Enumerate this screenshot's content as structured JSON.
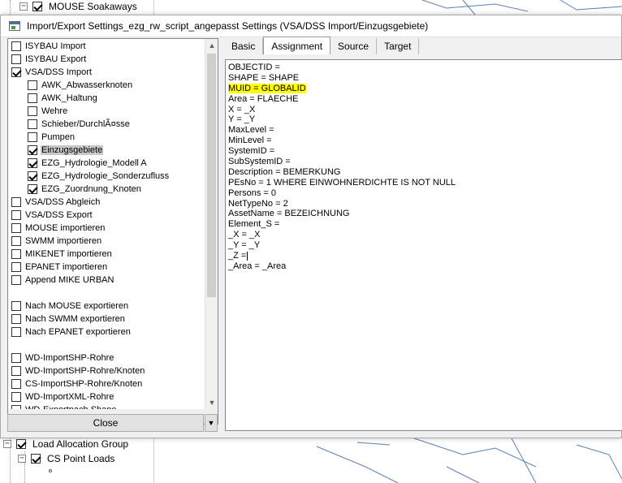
{
  "background": {
    "top_item": {
      "label": "MOUSE Soakaways",
      "checked": true
    },
    "bottom_items": [
      {
        "label": "Load Allocation Group",
        "checked": true
      },
      {
        "label": "CS Point Loads",
        "checked": true
      }
    ]
  },
  "dialog": {
    "title": "Import/Export Settings_ezg_rw_script_angepasst Settings (VSA/DSS Import/Einzugsgebiete)",
    "list_items": [
      {
        "label": "ISYBAU Import",
        "checked": false,
        "indent": 0
      },
      {
        "label": "ISYBAU Export",
        "checked": false,
        "indent": 0
      },
      {
        "label": "VSA/DSS Import",
        "checked": true,
        "indent": 0
      },
      {
        "label": "AWK_Abwasserknoten",
        "checked": false,
        "indent": 1
      },
      {
        "label": "AWK_Haltung",
        "checked": false,
        "indent": 1
      },
      {
        "label": "Wehre",
        "checked": false,
        "indent": 1
      },
      {
        "label": "Schieber/DurchlÃ¤sse",
        "checked": false,
        "indent": 1
      },
      {
        "label": "Pumpen",
        "checked": false,
        "indent": 1
      },
      {
        "label": "Einzugsgebiete",
        "checked": true,
        "indent": 1,
        "selected": true
      },
      {
        "label": "EZG_Hydrologie_Modell A",
        "checked": true,
        "indent": 1
      },
      {
        "label": "EZG_Hydrologie_Sonderzufluss",
        "checked": true,
        "indent": 1
      },
      {
        "label": "EZG_Zuordnung_Knoten",
        "checked": true,
        "indent": 1
      },
      {
        "label": "VSA/DSS Abgleich",
        "checked": false,
        "indent": 0
      },
      {
        "label": "VSA/DSS Export",
        "checked": false,
        "indent": 0
      },
      {
        "label": "MOUSE importieren",
        "checked": false,
        "indent": 0
      },
      {
        "label": "SWMM importieren",
        "checked": false,
        "indent": 0
      },
      {
        "label": "MIKENET importieren",
        "checked": false,
        "indent": 0
      },
      {
        "label": "EPANET importieren",
        "checked": false,
        "indent": 0
      },
      {
        "label": "Append MIKE URBAN",
        "checked": false,
        "indent": 0
      },
      {
        "label": "",
        "blank": true
      },
      {
        "label": "Nach MOUSE exportieren",
        "checked": false,
        "indent": 0
      },
      {
        "label": "Nach SWMM exportieren",
        "checked": false,
        "indent": 0
      },
      {
        "label": "Nach EPANET exportieren",
        "checked": false,
        "indent": 0
      },
      {
        "label": "",
        "blank": true
      },
      {
        "label": "WD-ImportSHP-Rohre",
        "checked": false,
        "indent": 0
      },
      {
        "label": "WD-ImportSHP-Rohre/Knoten",
        "checked": false,
        "indent": 0
      },
      {
        "label": "CS-ImportSHP-Rohre/Knoten",
        "checked": false,
        "indent": 0
      },
      {
        "label": "WD-ImportXML-Rohre",
        "checked": false,
        "indent": 0
      },
      {
        "label": "WD-Exportnach Shape",
        "checked": false,
        "indent": 0
      }
    ],
    "close_label": "Close",
    "tabs": [
      {
        "label": "Basic",
        "active": false
      },
      {
        "label": "Assignment",
        "active": true
      },
      {
        "label": "Source",
        "active": false
      },
      {
        "label": "Target",
        "active": false
      }
    ],
    "editor_lines": [
      "OBJECTID =",
      "SHAPE = SHAPE",
      "MUID = GLOBALID",
      "Area = FLAECHE",
      "X = _X",
      "Y = _Y",
      "MaxLevel =",
      "MinLevel =",
      "SystemID =",
      "SubSystemID =",
      "Description = BEMERKUNG",
      "PEsNo = 1 WHERE EINWOHNERDICHTE IS NOT NULL",
      "Persons = 0",
      "NetTypeNo = 2",
      "AssetName = BEZEICHNUNG",
      "Element_S =",
      "_X = _X",
      "_Y = _Y",
      "_Z =",
      "_Area = _Area"
    ],
    "highlighted_line": 2,
    "highlight_color": "#ffff00",
    "caret_line": 18
  }
}
